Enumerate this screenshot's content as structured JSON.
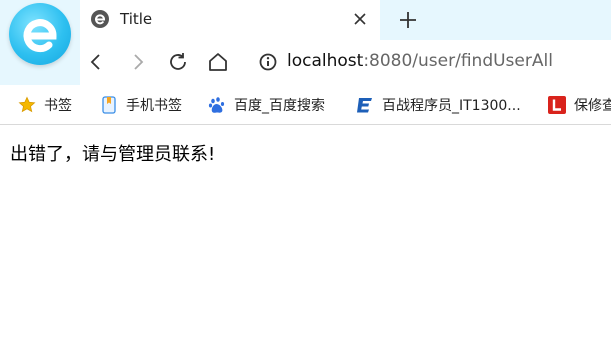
{
  "tab": {
    "title": "Title",
    "close_icon": "close-icon",
    "new_tab_icon": "plus-icon"
  },
  "address_bar": {
    "host": "localhost",
    "rest": ":8080/user/findUserAll"
  },
  "bookmarks": [
    {
      "label": "书签",
      "icon": "star-icon"
    },
    {
      "label": "手机书签",
      "icon": "mobile-bookmark-icon"
    },
    {
      "label": "百度_百度搜索",
      "icon": "baidu-icon"
    },
    {
      "label": "百战程序员_IT1300...",
      "icon": "baizhan-icon"
    },
    {
      "label": "保修查",
      "icon": "red-l-icon"
    }
  ],
  "page": {
    "error_message": "出错了，请与管理员联系!"
  },
  "colors": {
    "chrome_bg": "#e6f7fe",
    "logo_blue": "#2ec0f0"
  }
}
